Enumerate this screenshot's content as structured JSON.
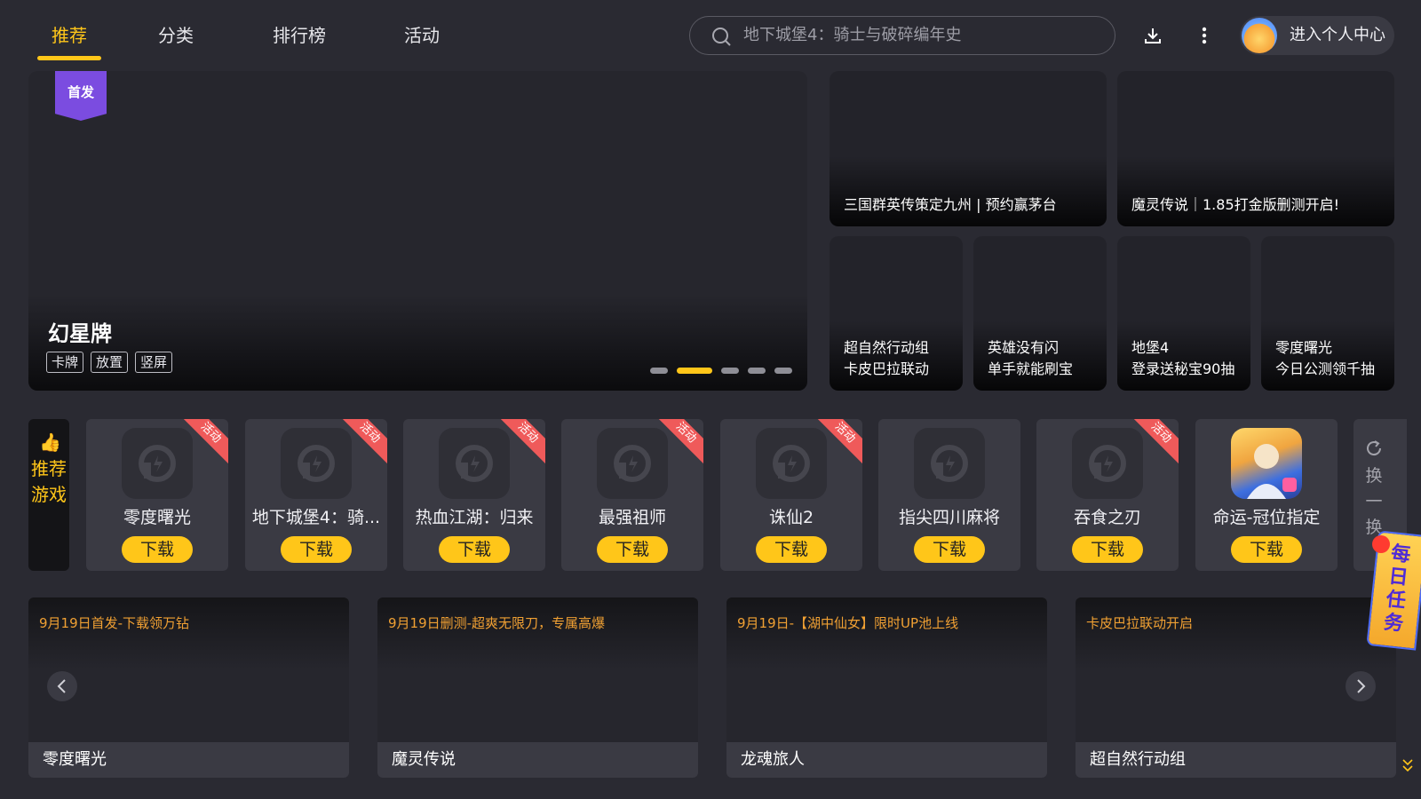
{
  "nav": {
    "tabs": [
      {
        "label": "推荐",
        "active": true
      },
      {
        "label": "分类",
        "active": false
      },
      {
        "label": "排行榜",
        "active": false
      },
      {
        "label": "活动",
        "active": false
      }
    ],
    "search_placeholder": "地下城堡4：骑士与破碎编年史",
    "profile_label": "进入个人中心",
    "accent_color": "#ffc619"
  },
  "hero": {
    "badge": "首发",
    "title": "幻星牌",
    "tags": [
      "卡牌",
      "放置",
      "竖屏"
    ],
    "carousel_dots": 5,
    "active_dot": 2
  },
  "promos": [
    {
      "text": "三国群英传策定九州 | 预约赢茅台"
    },
    {
      "text": "魔灵传说｜1.85打金版删测开启!"
    },
    {
      "text": "超自然行动组\n卡皮巴拉联动"
    },
    {
      "text": "英雄没有闪\n单手就能刷宝"
    },
    {
      "text": "地堡4\n登录送秘宝90抽"
    },
    {
      "text": "零度曙光\n今日公测领千抽"
    }
  ],
  "recommend": {
    "label": "推荐游戏",
    "download_label": "下载",
    "event_tag": "活动",
    "refresh_label": "换一换",
    "games": [
      {
        "name": "零度曙光",
        "event": true,
        "icon": "placeholder-game-icon"
      },
      {
        "name": "地下城堡4：骑...",
        "event": true,
        "icon": "placeholder-game-icon"
      },
      {
        "name": "热血江湖：归来",
        "event": true,
        "icon": "placeholder-game-icon"
      },
      {
        "name": "最强祖师",
        "event": true,
        "icon": "placeholder-game-icon"
      },
      {
        "name": "诛仙2",
        "event": true,
        "icon": "placeholder-game-icon"
      },
      {
        "name": "指尖四川麻将",
        "event": false,
        "icon": "placeholder-game-icon"
      },
      {
        "name": "吞食之刃",
        "event": true,
        "icon": "placeholder-game-icon"
      },
      {
        "name": "命运-冠位指定",
        "event": false,
        "icon": "fgo-icon"
      }
    ]
  },
  "news": [
    {
      "headline": "9月19日首发-下载领万钻",
      "game": "零度曙光"
    },
    {
      "headline": "9月19日删测-超爽无限刀，专属高爆",
      "game": "魔灵传说"
    },
    {
      "headline": "9月19日-【湖中仙女】限时UP池上线",
      "game": "龙魂旅人"
    },
    {
      "headline": "卡皮巴拉联动开启",
      "game": "超自然行动组"
    }
  ],
  "daily_task": {
    "label": "每日任务"
  }
}
